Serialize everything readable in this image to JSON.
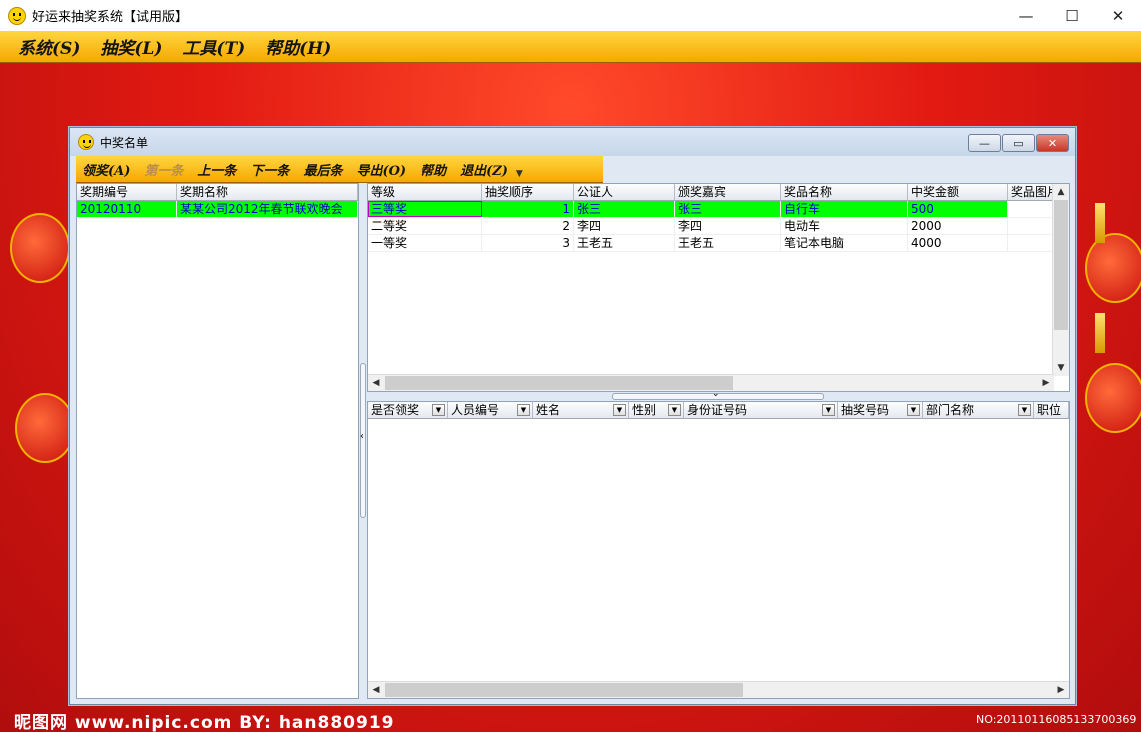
{
  "app": {
    "title": "好运来抽奖系统【试用版】"
  },
  "menu": [
    {
      "label": "系统(S)"
    },
    {
      "label": "抽奖(L)"
    },
    {
      "label": "工具(T)"
    },
    {
      "label": "帮助(H)"
    }
  ],
  "watermark": {
    "left": "昵图网 www.nipic.com  BY: han880919",
    "right": "NO:20110116085133700369"
  },
  "child": {
    "title": "中奖名单",
    "toolbar": [
      {
        "label": "领奖(A)",
        "enabled": true
      },
      {
        "label": "第一条",
        "enabled": false
      },
      {
        "label": "上一条",
        "enabled": true
      },
      {
        "label": "下一条",
        "enabled": true
      },
      {
        "label": "最后条",
        "enabled": true
      },
      {
        "label": "导出(O)",
        "enabled": true
      },
      {
        "label": "帮助",
        "enabled": true
      },
      {
        "label": "退出(Z)",
        "enabled": true
      }
    ],
    "periods": {
      "headers": [
        "奖期编号",
        "奖期名称"
      ],
      "rows": [
        [
          "20120110",
          "某某公司2012年春节联欢晚会"
        ]
      ]
    },
    "prizes": {
      "headers": [
        "等级",
        "抽奖顺序",
        "公证人",
        "颁奖嘉宾",
        "奖品名称",
        "中奖金额",
        "奖品图片"
      ],
      "rows": [
        [
          "三等奖",
          "1",
          "张三",
          "张三",
          "自行车",
          "500",
          ""
        ],
        [
          "二等奖",
          "2",
          "李四",
          "李四",
          "电动车",
          "2000",
          ""
        ],
        [
          "一等奖",
          "3",
          "王老五",
          "王老五",
          "笔记本电脑",
          "4000",
          ""
        ]
      ]
    },
    "winners": {
      "headers": [
        "是否领奖",
        "人员编号",
        "姓名",
        "性别",
        "身份证号码",
        "抽奖号码",
        "部门名称",
        "职位"
      ]
    }
  },
  "colors": {
    "accent": "#ffd640",
    "selected_row": "#00ff00",
    "selected_text": "#0000cc",
    "background": "#e21a12"
  }
}
